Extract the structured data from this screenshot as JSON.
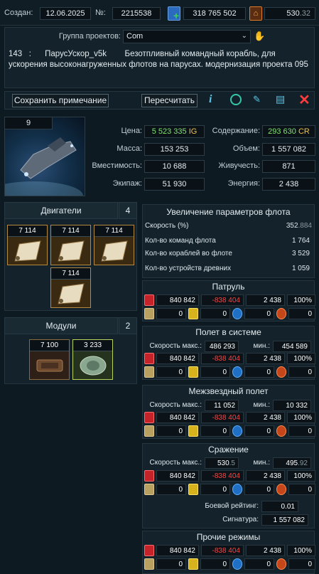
{
  "top": {
    "created_label": "Создан:",
    "created_value": "12.06.2025",
    "number_label": "№:",
    "number_value": "2215538",
    "credits_value": "318 765 502",
    "level_value": "530",
    "level_decimal": ".32"
  },
  "project": {
    "group_label": "Группа проектов:",
    "group_value": "Com",
    "description": "143   :      ПарусУскор_v5k        Безотпливный командный корабль, для ускорения высоконагруженных флотов на парусах. модернизация проекта 095"
  },
  "toolbar": {
    "save_note_label": "Сохранить примечание",
    "recalc_label": "Пересчитать"
  },
  "ship": {
    "level": "9",
    "price_label": "Цена:",
    "price_value": "5 523 335",
    "price_currency": "IG",
    "upkeep_label": "Содержание:",
    "upkeep_value": "293 630",
    "upkeep_currency": "CR",
    "mass_label": "Масса:",
    "mass_value": "153 253",
    "volume_label": "Объем:",
    "volume_value": "1 557 082",
    "capacity_label": "Вместимость:",
    "capacity_value": "10 688",
    "durability_label": "Живучесть:",
    "durability_value": "871",
    "crew_label": "Экипаж:",
    "crew_value": "51 930",
    "energy_label": "Энергия:",
    "energy_value": "2 438"
  },
  "engines": {
    "title": "Двигатели",
    "count": "4",
    "slots": [
      "7 114",
      "7 114",
      "7 114",
      "7 114"
    ]
  },
  "modules": {
    "title": "Модули",
    "count": "2",
    "slots": [
      "7 100",
      "3 233"
    ]
  },
  "fleet": {
    "title": "Увеличение параметров флота",
    "speed_label": "Скорость (%)",
    "speed_value": "352",
    "speed_decimal": ".884",
    "cmd_label": "Кол-во команд флота",
    "cmd_value": "1 764",
    "ships_label": "Кол-во кораблей во флоте",
    "ships_value": "3 529",
    "ancient_label": "Кол-во устройств древних",
    "ancient_value": "1 059"
  },
  "stat_row": {
    "a": "840 842",
    "b": "-838 404",
    "c": "2 438",
    "d": "100%",
    "z1": "0",
    "z2": "0",
    "z3": "0",
    "z4": "0"
  },
  "sections": {
    "patrol": "Патруль",
    "system": "Полет в системе",
    "interstellar": "Межзвездный полет",
    "battle": "Сражение",
    "other": "Прочие режимы"
  },
  "speeds": {
    "max_label": "Скорость макс.:",
    "min_label": "мин.:",
    "system_max": "486 293",
    "system_min": "454 589",
    "inter_max": "11 052",
    "inter_min": "10 332",
    "battle_max": "530",
    "battle_max_dec": ".5",
    "battle_min": "495",
    "battle_min_dec": ".92"
  },
  "battle": {
    "rating_label": "Боевой рейтинг:",
    "rating_value": "0.01",
    "signature_label": "Сигнатура:",
    "signature_value": "1 557 082"
  },
  "colors": {
    "accent_red": "#ff4242",
    "green": "#7ee36d",
    "gold": "#f0c14b"
  }
}
